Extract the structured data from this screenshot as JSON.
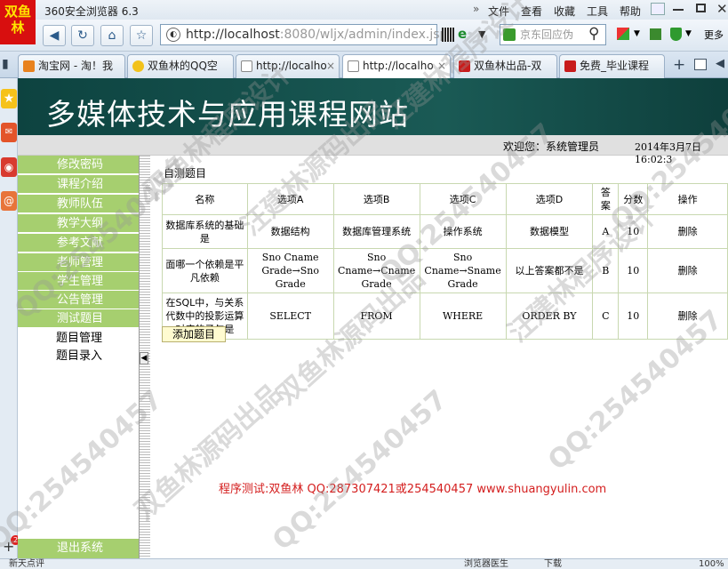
{
  "browser": {
    "logo_text": "双鱼林",
    "app_title": "360安全浏览器 6.3",
    "menus": [
      "文件",
      "查看",
      "收藏",
      "工具",
      "帮助"
    ],
    "address_main": "http://localhost",
    "address_rest": ":8080/wljx/admin/index.jsp",
    "search_placeholder": "京东回应伪",
    "more_label": "更多",
    "tabs": [
      {
        "label": "淘宝网 - 淘！我",
        "color": "#e8821e"
      },
      {
        "label": "双鱼林的QQ空",
        "color": "#f2c21b"
      },
      {
        "label": "http://localho",
        "color": "#ffffff"
      },
      {
        "label": "http://localho",
        "color": "#ffffff"
      },
      {
        "label": "双鱼林出品-双",
        "color": "#c81c1c"
      },
      {
        "label": "免费_毕业课程",
        "color": "#c81c1c"
      }
    ],
    "status_left": "新天点评",
    "status_mid": "浏览器医生",
    "status_download": "下载",
    "status_zoom": "100%"
  },
  "site": {
    "title": "多媒体技术与应用课程网站",
    "welcome": "欢迎您：系统管理员",
    "date": "2014年3月7日  16:02:3"
  },
  "nav": {
    "items": [
      "修改密码",
      "课程介绍",
      "教师队伍",
      "教学大纲",
      "参考文献",
      "老师管理",
      "学生管理",
      "公告管理",
      "测试题目"
    ],
    "subitems": [
      "题目管理",
      "题目录入"
    ],
    "logout": "退出系统"
  },
  "content": {
    "section_title": "自测题目",
    "headers": [
      "名称",
      "选项A",
      "选项B",
      "选项C",
      "选项D",
      "答案",
      "分数",
      "操作"
    ],
    "rows": [
      {
        "name": "数据库系统的基础是",
        "a": "数据结构",
        "b": "数据库管理系统",
        "c": "操作系统",
        "d": "数据模型",
        "answer": "A",
        "score": "10",
        "op": "删除"
      },
      {
        "name": "面哪一个依赖是平凡依赖",
        "a": "Sno Cname Grade→Sno Grade",
        "b": "Sno Cname→Cname Grade",
        "c": "Sno Cname→Sname Grade",
        "d": "以上答案都不是",
        "answer": "B",
        "score": "10",
        "op": "删除"
      },
      {
        "name": "在SQL中，与关系代数中的投影运算对应的子句是",
        "a": "SELECT",
        "b": "FROM",
        "c": "WHERE",
        "d": "ORDER BY",
        "answer": "C",
        "score": "10",
        "op": "删除"
      }
    ],
    "add_button": "添加题目",
    "credit": "程序测试:双鱼林 QQ:287307421或254540457 www.shuangyulin.com"
  },
  "watermarks": [
    "QQ:254540457",
    "双鱼林程序设计",
    "汪建林源码出品",
    "QQ:254540457",
    "双鱼林源码出品",
    "QQ:254540457",
    "汪建林程序设计",
    "QQ:254540457",
    "双鱼林源码出品",
    "QQ:254540457",
    "汪建林程序设计",
    "QQ:254540457"
  ]
}
